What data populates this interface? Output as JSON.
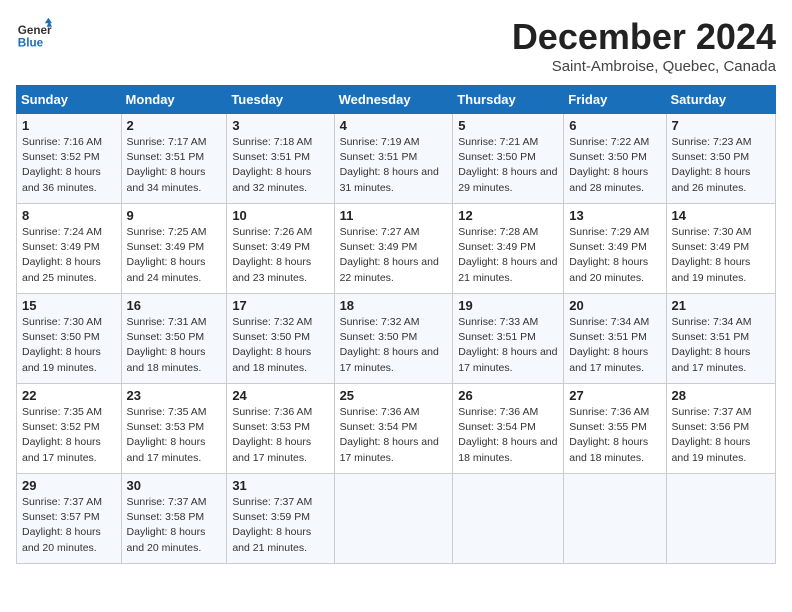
{
  "logo": {
    "line1": "General",
    "line2": "Blue"
  },
  "title": "December 2024",
  "subtitle": "Saint-Ambroise, Quebec, Canada",
  "days_of_week": [
    "Sunday",
    "Monday",
    "Tuesday",
    "Wednesday",
    "Thursday",
    "Friday",
    "Saturday"
  ],
  "weeks": [
    [
      {
        "day": "1",
        "sunrise": "7:16 AM",
        "sunset": "3:52 PM",
        "daylight": "8 hours and 36 minutes."
      },
      {
        "day": "2",
        "sunrise": "7:17 AM",
        "sunset": "3:51 PM",
        "daylight": "8 hours and 34 minutes."
      },
      {
        "day": "3",
        "sunrise": "7:18 AM",
        "sunset": "3:51 PM",
        "daylight": "8 hours and 32 minutes."
      },
      {
        "day": "4",
        "sunrise": "7:19 AM",
        "sunset": "3:51 PM",
        "daylight": "8 hours and 31 minutes."
      },
      {
        "day": "5",
        "sunrise": "7:21 AM",
        "sunset": "3:50 PM",
        "daylight": "8 hours and 29 minutes."
      },
      {
        "day": "6",
        "sunrise": "7:22 AM",
        "sunset": "3:50 PM",
        "daylight": "8 hours and 28 minutes."
      },
      {
        "day": "7",
        "sunrise": "7:23 AM",
        "sunset": "3:50 PM",
        "daylight": "8 hours and 26 minutes."
      }
    ],
    [
      {
        "day": "8",
        "sunrise": "7:24 AM",
        "sunset": "3:49 PM",
        "daylight": "8 hours and 25 minutes."
      },
      {
        "day": "9",
        "sunrise": "7:25 AM",
        "sunset": "3:49 PM",
        "daylight": "8 hours and 24 minutes."
      },
      {
        "day": "10",
        "sunrise": "7:26 AM",
        "sunset": "3:49 PM",
        "daylight": "8 hours and 23 minutes."
      },
      {
        "day": "11",
        "sunrise": "7:27 AM",
        "sunset": "3:49 PM",
        "daylight": "8 hours and 22 minutes."
      },
      {
        "day": "12",
        "sunrise": "7:28 AM",
        "sunset": "3:49 PM",
        "daylight": "8 hours and 21 minutes."
      },
      {
        "day": "13",
        "sunrise": "7:29 AM",
        "sunset": "3:49 PM",
        "daylight": "8 hours and 20 minutes."
      },
      {
        "day": "14",
        "sunrise": "7:30 AM",
        "sunset": "3:49 PM",
        "daylight": "8 hours and 19 minutes."
      }
    ],
    [
      {
        "day": "15",
        "sunrise": "7:30 AM",
        "sunset": "3:50 PM",
        "daylight": "8 hours and 19 minutes."
      },
      {
        "day": "16",
        "sunrise": "7:31 AM",
        "sunset": "3:50 PM",
        "daylight": "8 hours and 18 minutes."
      },
      {
        "day": "17",
        "sunrise": "7:32 AM",
        "sunset": "3:50 PM",
        "daylight": "8 hours and 18 minutes."
      },
      {
        "day": "18",
        "sunrise": "7:32 AM",
        "sunset": "3:50 PM",
        "daylight": "8 hours and 17 minutes."
      },
      {
        "day": "19",
        "sunrise": "7:33 AM",
        "sunset": "3:51 PM",
        "daylight": "8 hours and 17 minutes."
      },
      {
        "day": "20",
        "sunrise": "7:34 AM",
        "sunset": "3:51 PM",
        "daylight": "8 hours and 17 minutes."
      },
      {
        "day": "21",
        "sunrise": "7:34 AM",
        "sunset": "3:51 PM",
        "daylight": "8 hours and 17 minutes."
      }
    ],
    [
      {
        "day": "22",
        "sunrise": "7:35 AM",
        "sunset": "3:52 PM",
        "daylight": "8 hours and 17 minutes."
      },
      {
        "day": "23",
        "sunrise": "7:35 AM",
        "sunset": "3:53 PM",
        "daylight": "8 hours and 17 minutes."
      },
      {
        "day": "24",
        "sunrise": "7:36 AM",
        "sunset": "3:53 PM",
        "daylight": "8 hours and 17 minutes."
      },
      {
        "day": "25",
        "sunrise": "7:36 AM",
        "sunset": "3:54 PM",
        "daylight": "8 hours and 17 minutes."
      },
      {
        "day": "26",
        "sunrise": "7:36 AM",
        "sunset": "3:54 PM",
        "daylight": "8 hours and 18 minutes."
      },
      {
        "day": "27",
        "sunrise": "7:36 AM",
        "sunset": "3:55 PM",
        "daylight": "8 hours and 18 minutes."
      },
      {
        "day": "28",
        "sunrise": "7:37 AM",
        "sunset": "3:56 PM",
        "daylight": "8 hours and 19 minutes."
      }
    ],
    [
      {
        "day": "29",
        "sunrise": "7:37 AM",
        "sunset": "3:57 PM",
        "daylight": "8 hours and 20 minutes."
      },
      {
        "day": "30",
        "sunrise": "7:37 AM",
        "sunset": "3:58 PM",
        "daylight": "8 hours and 20 minutes."
      },
      {
        "day": "31",
        "sunrise": "7:37 AM",
        "sunset": "3:59 PM",
        "daylight": "8 hours and 21 minutes."
      },
      null,
      null,
      null,
      null
    ]
  ],
  "labels": {
    "sunrise": "Sunrise:",
    "sunset": "Sunset:",
    "daylight": "Daylight:"
  }
}
